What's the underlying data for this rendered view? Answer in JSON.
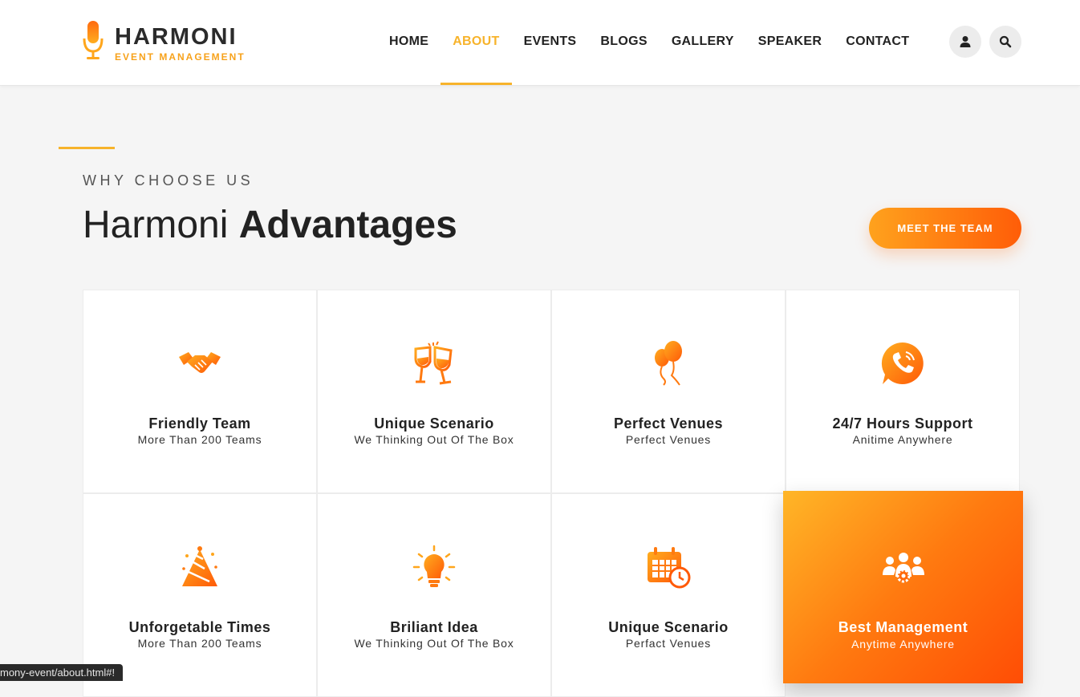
{
  "brand": {
    "name": "HARMONI",
    "tagline": "EVENT MANAGEMENT"
  },
  "nav": [
    {
      "label": "HOME",
      "active": false
    },
    {
      "label": "ABOUT",
      "active": true
    },
    {
      "label": "EVENTS",
      "active": false
    },
    {
      "label": "BLOGS",
      "active": false
    },
    {
      "label": "GALLERY",
      "active": false
    },
    {
      "label": "SPEAKER",
      "active": false
    },
    {
      "label": "CONTACT",
      "active": false
    }
  ],
  "header_icons": [
    "user-icon",
    "search-icon"
  ],
  "section": {
    "eyebrow": "WHY CHOOSE US",
    "title_light": "Harmoni",
    "title_bold": "Advantages",
    "cta": "MEET THE TEAM"
  },
  "features": [
    {
      "icon": "handshake-icon",
      "title": "Friendly Team",
      "subtitle": "More Than 200 Teams"
    },
    {
      "icon": "wine-glasses-icon",
      "title": "Unique Scenario",
      "subtitle": "We Thinking Out Of The Box"
    },
    {
      "icon": "balloons-icon",
      "title": "Perfect Venues",
      "subtitle": "Perfect Venues"
    },
    {
      "icon": "phone-support-icon",
      "title": "24/7 Hours Support",
      "subtitle": "Anitime Anywhere"
    },
    {
      "icon": "party-hat-icon",
      "title": "Unforgetable Times",
      "subtitle": "More Than 200 Teams"
    },
    {
      "icon": "light-bulb-icon",
      "title": "Briliant Idea",
      "subtitle": "We Thinking Out Of The Box"
    },
    {
      "icon": "calendar-clock-icon",
      "title": "Unique Scenario",
      "subtitle": "Perfact Venues"
    },
    {
      "icon": "team-gear-icon",
      "title": "Best Management",
      "subtitle": "Anytime Anywhere",
      "highlighted": true
    }
  ],
  "status_bar": "mony-event/about.html#!",
  "colors": {
    "accent": "#f7b32b",
    "orange": "#ff7a10",
    "orange_dark": "#ff4d05"
  }
}
